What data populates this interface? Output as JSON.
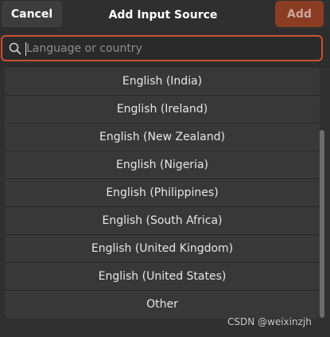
{
  "header": {
    "cancel_label": "Cancel",
    "title": "Add Input Source",
    "add_label": "Add"
  },
  "search": {
    "placeholder": "Language or country",
    "value": ""
  },
  "languages": [
    "English (India)",
    "English (Ireland)",
    "English (New Zealand)",
    "English (Nigeria)",
    "English (Philippines)",
    "English (South Africa)",
    "English (United Kingdom)",
    "English (United States)",
    "Other"
  ],
  "watermark": "CSDN @weixinzjh",
  "colors": {
    "accent": "#c9512f",
    "add_button": "#8a3d22",
    "background": "#2d2d2d",
    "list_bg": "#383838"
  },
  "icons": {
    "search": "search-icon"
  }
}
